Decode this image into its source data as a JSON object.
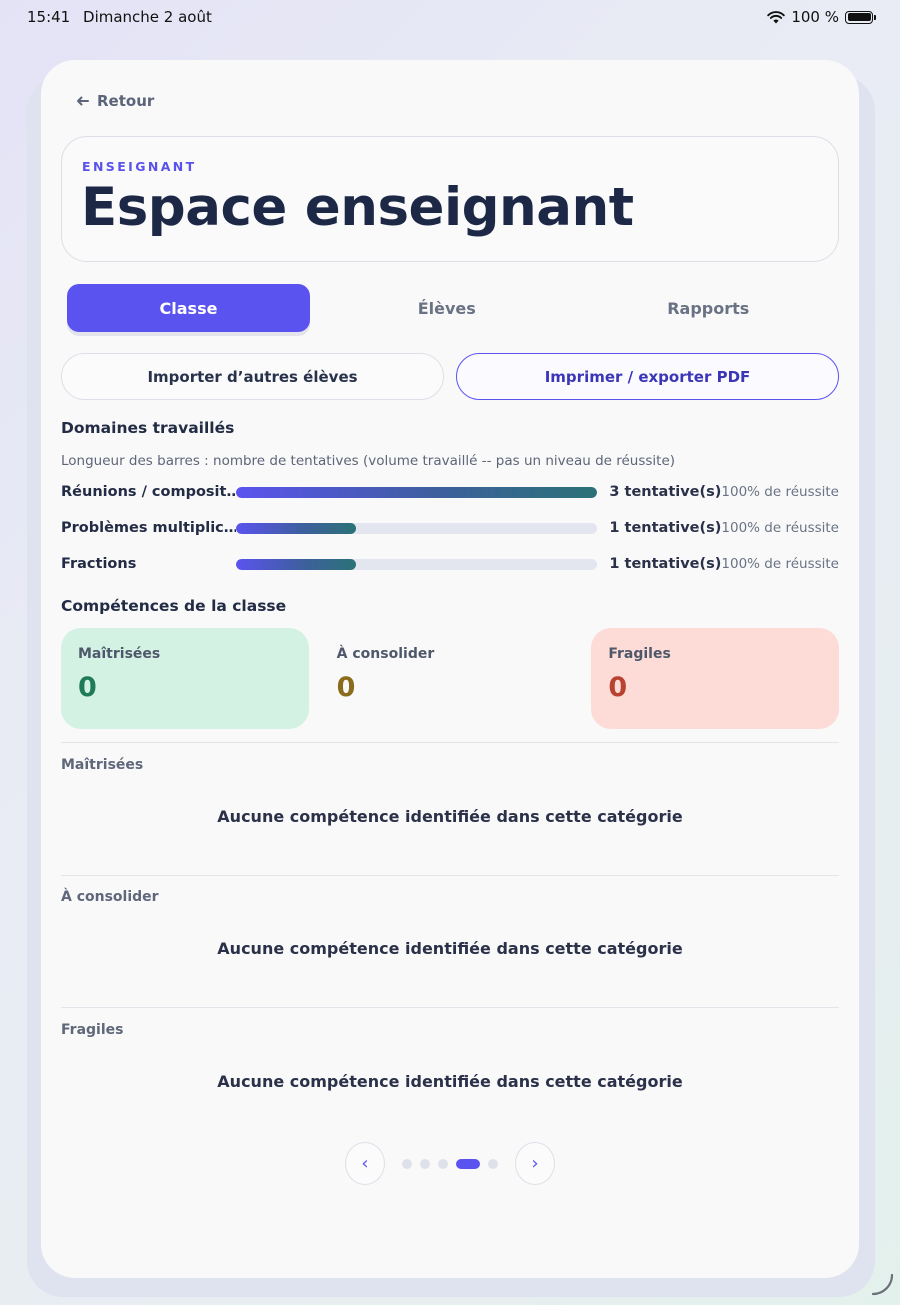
{
  "status_bar": {
    "time": "15:41",
    "date": "Dimanche 2 août",
    "battery": "100 %"
  },
  "nav": {
    "back_label": "Retour"
  },
  "header": {
    "eyebrow": "ENSEIGNANT",
    "title": "Espace enseignant"
  },
  "tabs": [
    {
      "label": "Classe",
      "active": true
    },
    {
      "label": "Élèves",
      "active": false
    },
    {
      "label": "Rapports",
      "active": false
    }
  ],
  "actions": {
    "import_label": "Importer d’autres élèves",
    "export_label": "Imprimer / exporter PDF"
  },
  "domains": {
    "title": "Domaines travaillés",
    "note": "Longueur des barres : nombre de tentatives (volume travaillé -- pas un niveau de réussite)",
    "items": [
      {
        "name": "Réunions / composit…",
        "attempts_label": "3 tentative(s)",
        "attempts": 3,
        "success_label": "100% de réussite"
      },
      {
        "name": "Problèmes multiplic…",
        "attempts_label": "1 tentative(s)",
        "attempts": 1,
        "success_label": "100% de réussite"
      },
      {
        "name": "Fractions",
        "attempts_label": "1 tentative(s)",
        "attempts": 1,
        "success_label": "100% de réussite"
      }
    ]
  },
  "competences": {
    "title": "Compétences de la classe",
    "stats": [
      {
        "label": "Maîtrisées",
        "value": "0"
      },
      {
        "label": "À consolider",
        "value": "0"
      },
      {
        "label": "Fragiles",
        "value": "0"
      }
    ],
    "categories": [
      {
        "label": "Maîtrisées",
        "empty_message": "Aucune compétence identifiée dans cette catégorie"
      },
      {
        "label": "À consolider",
        "empty_message": "Aucune compétence identifiée dans cette catégorie"
      },
      {
        "label": "Fragiles",
        "empty_message": "Aucune compétence identifiée dans cette catégorie"
      }
    ]
  },
  "pager": {
    "prev": "‹",
    "next": "›",
    "page_count": 5,
    "current_page": 4
  },
  "colors": {
    "accent": "#5b53ef",
    "green": "#1f7a58",
    "amber": "#8a6c1a",
    "red": "#b8422f"
  }
}
